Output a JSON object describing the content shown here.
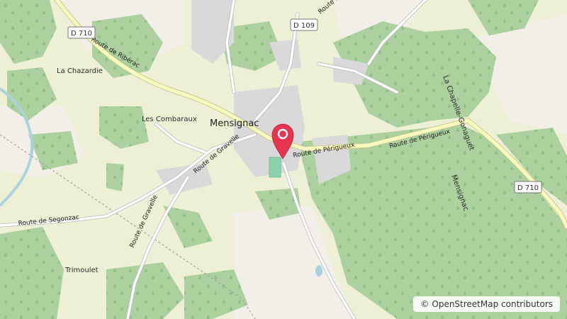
{
  "map": {
    "town_label": "Mensignac",
    "places": {
      "la_chazardie": "La Chazardie",
      "les_combaraux": "Les Combaraux",
      "trimoulet": "Trimoulet",
      "la_chapelle_gonaguet": "La Chapelle-Gonaguet",
      "mensignac_commune": "Mensignac"
    },
    "roads": {
      "route_de_riberac": "Route de Ribérac",
      "route_de_gravelle_1": "Route de Gravelle",
      "route_de_gravelle_2": "Route de Gravelle",
      "route_de_segonzac": "Route de Segonzac",
      "route_de_perigueux_1": "Route de Périgueux",
      "route_de_perigueux_2": "Route de Périgueux",
      "route_gouttiere": "Route de"
    },
    "shields": {
      "d710_left": "D 710",
      "d109": "D 109",
      "d710_right": "D 710"
    },
    "attribution": {
      "symbol": "©",
      "text": "OpenStreetMap contributors"
    },
    "colors": {
      "land": "#f2efe9",
      "farmland": "#eef0d5",
      "forest": "#add19e",
      "residential": "#d9d9d9",
      "major_road": "#f7fabf",
      "marker": "#e8344e"
    }
  }
}
